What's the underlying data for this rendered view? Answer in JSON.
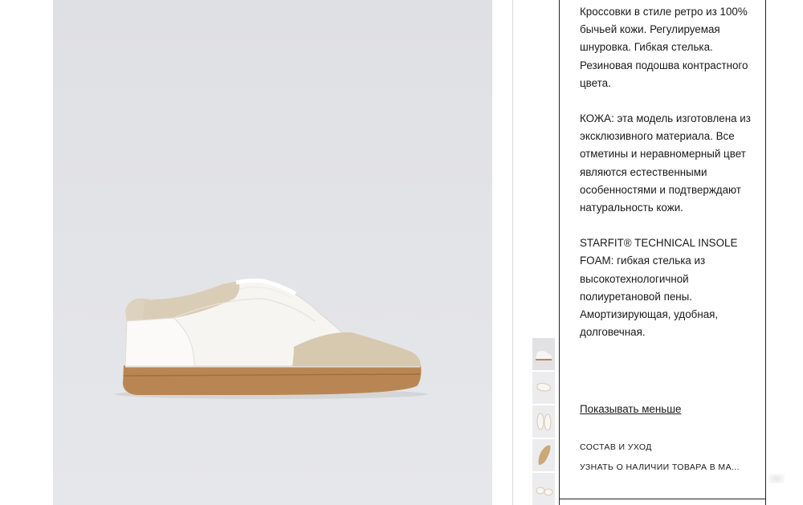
{
  "product": {
    "image_alt_icon": "sneaker-photo",
    "description_paragraphs": [
      "Кроссовки в стиле ретро из 100% бычьей кожи. Регулируемая шнуровка. Гибкая стелька. Резиновая подошва контрастного цвета.",
      "КОЖА: эта модель изготовлена из эксклюзивного материала. Все отметины и неравномерный цвет являются естественными особенностями и подтверждают натуральность кожи.",
      "STARFIT® TECHNICAL INSOLE FOAM: гибкая стелька из высокотехнологичной полиуретановой пены. Амортизирующая, удобная, долговечная."
    ],
    "show_less_label": "Показывать меньше",
    "care_label": "СОСТАВ И УХОД",
    "availability_label": "УЗНАТЬ О НАЛИЧИИ ТОВАРА В МА..."
  },
  "thumbnails": [
    {
      "icon": "sneaker-side-thumb",
      "active": true
    },
    {
      "icon": "sneaker-top-thumb",
      "active": false
    },
    {
      "icon": "sneaker-pair-thumb",
      "active": false
    },
    {
      "icon": "sneaker-sole-thumb",
      "active": false
    },
    {
      "icon": "sneaker-detail-thumb",
      "active": false
    }
  ],
  "colors": {
    "background": "#ffffff",
    "photo_bg": "#e2e3e7",
    "leather": "#f6f5f2",
    "suede": "#d9cdb6",
    "sole": "#b98653",
    "text": "#1a1a1a",
    "border": "#222222"
  }
}
